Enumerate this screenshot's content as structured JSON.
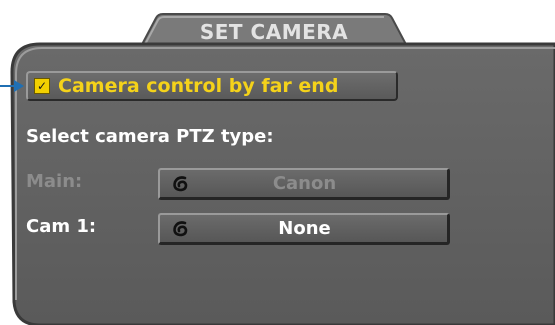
{
  "dialog": {
    "title": "SET CAMERA"
  },
  "checkbox": {
    "label": "Camera control by far end",
    "checked": true,
    "check_glyph": "✓"
  },
  "section": {
    "label": "Select camera PTZ type:"
  },
  "rows": [
    {
      "label": "Main:",
      "value": "Canon",
      "enabled": false,
      "icon": "swirl-icon"
    },
    {
      "label": "Cam 1:",
      "value": "None",
      "enabled": true,
      "icon": "swirl-icon"
    }
  ],
  "colors": {
    "panel": "#626262",
    "tab": "#7a7a7a",
    "accent": "#f4d21a",
    "pointer": "#1f6fb3",
    "disabled_text": "#8c8c8c"
  }
}
